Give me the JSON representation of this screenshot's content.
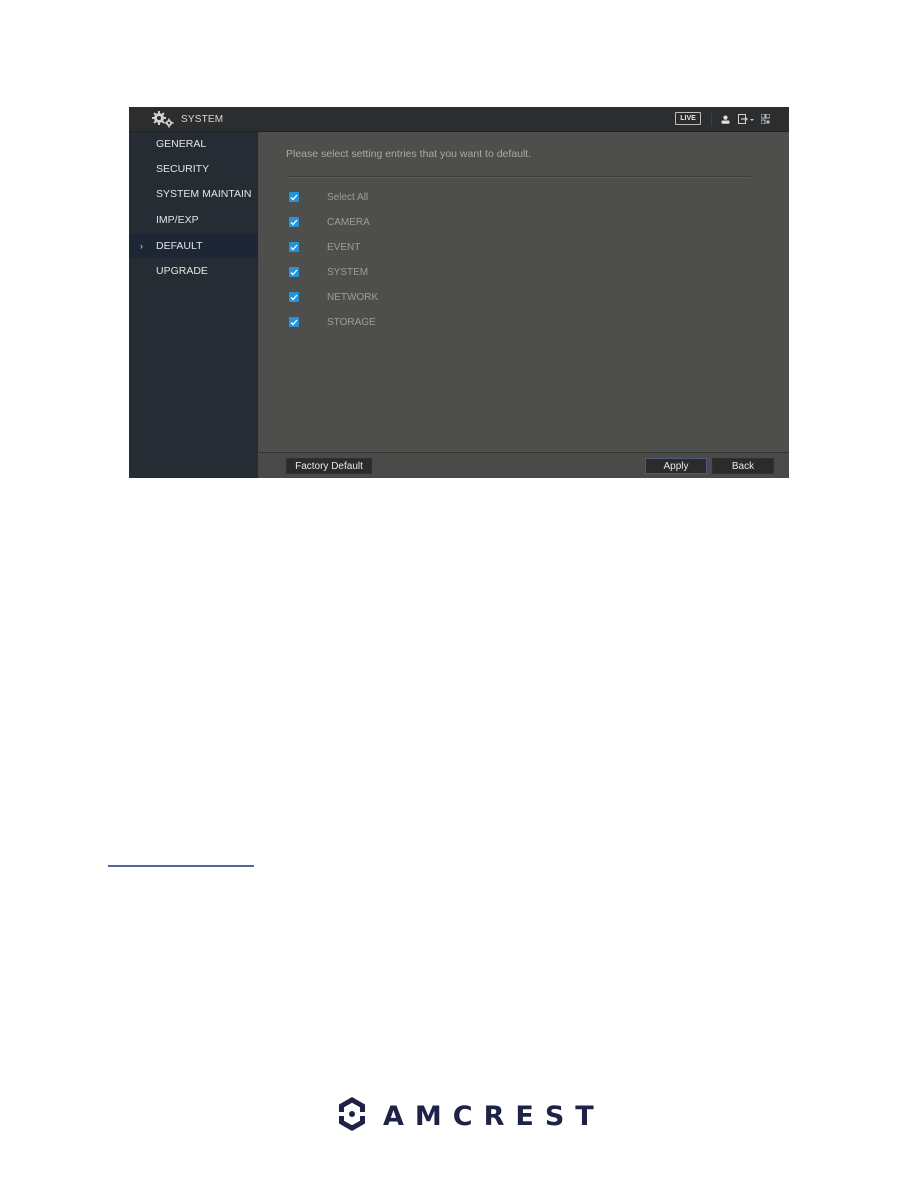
{
  "window": {
    "title": "SYSTEM",
    "title_icon": "gear-icon",
    "toolbar": {
      "live_label": "LIVE",
      "icons": [
        "user-icon",
        "logout-icon",
        "qr-code-icon"
      ]
    }
  },
  "sidebar": {
    "items": [
      {
        "label": "GENERAL",
        "active": false
      },
      {
        "label": "SECURITY",
        "active": false
      },
      {
        "label": "SYSTEM MAINTAIN",
        "active": false
      },
      {
        "label": "IMP/EXP",
        "active": false
      },
      {
        "label": "DEFAULT",
        "active": true
      },
      {
        "label": "UPGRADE",
        "active": false
      }
    ],
    "active_marker": "›"
  },
  "main": {
    "prompt": "Please select setting entries that you want to default.",
    "options": [
      {
        "label": "Select All",
        "checked": true
      },
      {
        "label": "CAMERA",
        "checked": true
      },
      {
        "label": "EVENT",
        "checked": true
      },
      {
        "label": "SYSTEM",
        "checked": true
      },
      {
        "label": "NETWORK",
        "checked": true
      },
      {
        "label": "STORAGE",
        "checked": true
      }
    ]
  },
  "footer": {
    "factory_default_label": "Factory Default",
    "apply_label": "Apply",
    "back_label": "Back"
  },
  "brand": {
    "name": "AMCREST",
    "color": "#1d2246",
    "accent": "#2494d9"
  }
}
